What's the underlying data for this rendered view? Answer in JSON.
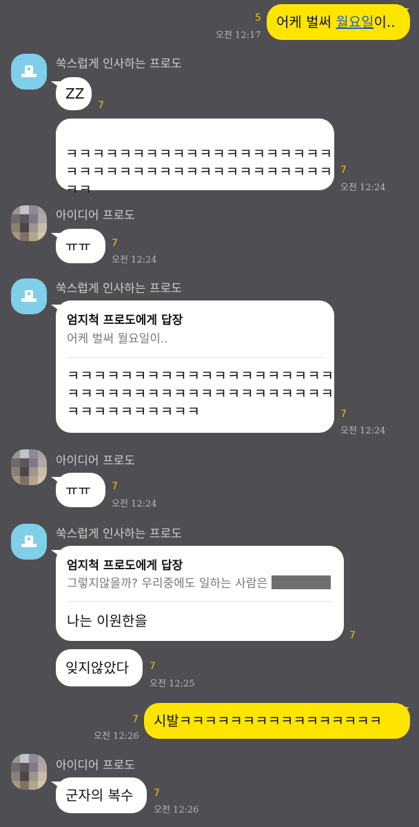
{
  "messages": {
    "m1": {
      "text_a": "어케 벌써 ",
      "text_link": "월요일",
      "text_b": "이..",
      "unread": "5",
      "time": "오전 12:17"
    },
    "m2": {
      "sender": "쑥스럽게 인사하는 프로도",
      "text": "ZZ",
      "unread": "7"
    },
    "m3": {
      "text": "ㅋㅋㅋㅋㅋㅋㅋㅋㅋㅋㅋㅋㅋㅋㅋㅋㅋㅋㅋㅋ\nㅋㅋㅋㅋㅋㅋㅋㅋㅋㅋㅋㅋㅋㅋㅋㅋㅋㅋㅋㅋ\nㅋㅋ",
      "unread": "7",
      "time": "오전 12:24"
    },
    "m4": {
      "sender": "아이디어 프로도",
      "text": "ㅠㅠ",
      "unread": "7",
      "time": "오전 12:24"
    },
    "m5": {
      "sender": "쑥스럽게 인사하는 프로도",
      "reply_head": "엄지척 프로도에게 답장",
      "reply_sub": "어케 벌써 월요일이..",
      "text": "ㅋㅋㅋㅋㅋㅋㅋㅋㅋㅋㅋㅋㅋㅋㅋㅋㅋㅋㅋㅋ\nㅋㅋㅋㅋㅋㅋㅋㅋㅋㅋㅋㅋㅋㅋㅋㅋㅋㅋㅋㅋ\nㅋㅋㅋㅋㅋㅋㅋㅋㅋㅋ",
      "unread": "7",
      "time": "오전 12:24"
    },
    "m6": {
      "sender": "아이디어 프로도",
      "text": "ㅠㅠ",
      "unread": "7",
      "time": "오전 12:24"
    },
    "m7": {
      "sender": "쑥스럽게 인사하는 프로도",
      "reply_head": "엄지척 프로도에게 답장",
      "reply_sub": "그렇지않을까? 우리중에도 일하는 사람은",
      "text": "나는 이원한을",
      "unread": "7"
    },
    "m8": {
      "text": "잊지않았다",
      "unread": "7",
      "time": "오전 12:25"
    },
    "m9": {
      "text": "시발ㅋㅋㅋㅋㅋㅋㅋㅋㅋㅋㅋㅋㅋㅋㅋㅋ",
      "unread": "7",
      "time": "오전 12:26"
    },
    "m10": {
      "sender": "아이디어 프로도",
      "text": "군자의 복수",
      "unread": "7",
      "time": "오전 12:26"
    }
  },
  "colors": {
    "background": "#4f4e52",
    "my_bubble": "#fee500",
    "their_bubble": "#ffffff",
    "unread": "#f2c400",
    "frodo_avatar": "#7fcfe8"
  },
  "icons": {
    "frodo_avatar": "ghost-icon",
    "idea_avatar": "pixelated-avatar"
  }
}
